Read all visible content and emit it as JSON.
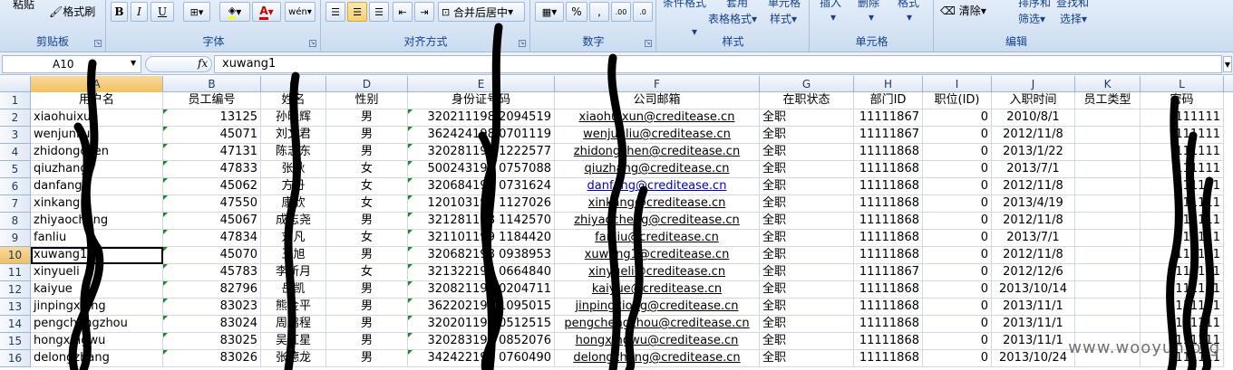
{
  "ribbon": {
    "clipboard": {
      "paste_label": "粘贴",
      "format_painter_label": "格式刷",
      "group_label": "剪贴板"
    },
    "font": {
      "bold": "B",
      "italic": "I",
      "underline": "U",
      "font_color_glyph": "A",
      "wen": "wén",
      "group_label": "字体"
    },
    "alignment": {
      "merge_center_label": "合并后居中",
      "group_label": "对齐方式"
    },
    "number": {
      "percent": "%",
      "comma": ",",
      "inc_decimal": ".00",
      "dec_decimal": ".0",
      "group_label": "数字"
    },
    "styles": {
      "conditional_format": "条件格式",
      "table_format_top": "套用",
      "table_format": "表格格式",
      "cell_styles_top": "单元格",
      "cell_styles": "样式",
      "group_label": "样式"
    },
    "cells": {
      "insert": "插入",
      "delete": "删除",
      "format": "格式",
      "group_label": "单元格"
    },
    "editing": {
      "clear_label": "清除",
      "sort_filter_top": "排序和",
      "sort_filter": "筛选",
      "find_select_top": "查找和",
      "find_select": "选择",
      "group_label": "编辑"
    }
  },
  "formula_bar": {
    "name_box": "A10",
    "fx": "fx",
    "formula": "xuwang1"
  },
  "columns": [
    "A",
    "B",
    "C",
    "D",
    "E",
    "F",
    "G",
    "H",
    "I",
    "J",
    "K",
    "L"
  ],
  "selected_column": "A",
  "selected_row": 10,
  "rows": [
    {
      "n": "1",
      "cells": [
        "用户名",
        "员工编号",
        "姓名",
        "性别",
        "身份证号码",
        "公司邮箱",
        "在职状态",
        "部门ID",
        "职位(ID)",
        "入职时间",
        "员工类型",
        "密码"
      ]
    },
    {
      "n": "2",
      "cells": [
        "xiaohuixun",
        "13125",
        "孙晓辉",
        "男",
        "320211198 2094519",
        "xiaohuixun@creditease.cn",
        "全职",
        "11111867",
        "0",
        "2010/8/1",
        "",
        "111111"
      ]
    },
    {
      "n": "3",
      "cells": [
        "wenjunliu",
        "45071",
        "刘文君",
        "男",
        "362424198 0701119",
        "wenjunliu@creditease.cn",
        "全职",
        "11111867",
        "0",
        "2012/11/8",
        "",
        "111111"
      ]
    },
    {
      "n": "4",
      "cells": [
        "zhidongchen",
        "47131",
        "陈志东",
        "男",
        "320281198 1222577",
        "zhidongchen@creditease.cn",
        "全职",
        "11111868",
        "0",
        "2013/1/22",
        "",
        "111111"
      ]
    },
    {
      "n": "5",
      "cells": [
        "qiuzhang",
        "47833",
        "张秋",
        "女",
        "500243199 0757088",
        "qiuzhang@creditease.cn",
        "全职",
        "11111868",
        "0",
        "2013/7/1",
        "",
        "111111"
      ]
    },
    {
      "n": "6",
      "cells": [
        "danfang",
        "45062",
        "方丹",
        "女",
        "320684199 0731624",
        "danfang@creditease.cn",
        "全职",
        "11111868",
        "0",
        "2012/11/8",
        "",
        "111111"
      ]
    },
    {
      "n": "7",
      "cells": [
        "xinkang",
        "47550",
        "康欣",
        "女",
        "120103199 1127026",
        "xinkang@creditease.cn",
        "全职",
        "11111868",
        "0",
        "2013/4/19",
        "",
        "111111"
      ]
    },
    {
      "n": "8",
      "cells": [
        "zhiyaocheng",
        "45067",
        "成志尧",
        "男",
        "321281198 1142570",
        "zhiyaocheng@creditease.cn",
        "全职",
        "11111868",
        "0",
        "2012/11/8",
        "",
        "111111"
      ]
    },
    {
      "n": "9",
      "cells": [
        "fanliu",
        "47834",
        "刘凡",
        "女",
        "321101199 1184420",
        "fanliu@creditease.cn",
        "全职",
        "11111868",
        "0",
        "2013/7/1",
        "",
        "111111"
      ]
    },
    {
      "n": "10",
      "cells": [
        "xuwang1",
        "45070",
        "王旭",
        "男",
        "320682198 0938953",
        "xuwang1@creditease.cn",
        "全职",
        "11111868",
        "0",
        "2012/11/8",
        "",
        "111111"
      ]
    },
    {
      "n": "11",
      "cells": [
        "xinyueli",
        "45783",
        "李新月",
        "女",
        "321322198 0664840",
        "xinyueli@creditease.cn",
        "全职",
        "11111867",
        "0",
        "2012/12/6",
        "",
        "111111"
      ]
    },
    {
      "n": "12",
      "cells": [
        "kaiyue",
        "82796",
        "岳凯",
        "男",
        "320821199 0204711",
        "kaiyue@creditease.cn",
        "全职",
        "11111868",
        "0",
        "2013/10/14",
        "",
        "111111"
      ]
    },
    {
      "n": "13",
      "cells": [
        "jinpingxiong",
        "83023",
        "熊金平",
        "男",
        "362202199 1095015",
        "jinpingxiong@creditease.cn",
        "全职",
        "11111868",
        "0",
        "2013/11/1",
        "",
        "111111"
      ]
    },
    {
      "n": "14",
      "cells": [
        "pengchengzhou",
        "83024",
        "周鹏程",
        "男",
        "320201199 0512515",
        "pengchengzhou@creditease.cn",
        "全职",
        "11111868",
        "0",
        "2013/11/1",
        "",
        "111111"
      ]
    },
    {
      "n": "15",
      "cells": [
        "hongxingwu",
        "83025",
        "吴红星",
        "男",
        "320283198 0852076",
        "hongxingwu@creditease.cn",
        "全职",
        "11111868",
        "0",
        "2013/11/1",
        "",
        "111111"
      ]
    },
    {
      "n": "16",
      "cells": [
        "delongzhang",
        "83026",
        "张德龙",
        "男",
        "342422198 0760490",
        "delongzhang@creditease.cn",
        "全职",
        "11111868",
        "0",
        "2013/10/24",
        "",
        "111111"
      ]
    }
  ],
  "watermark": "www.wooyun.org"
}
